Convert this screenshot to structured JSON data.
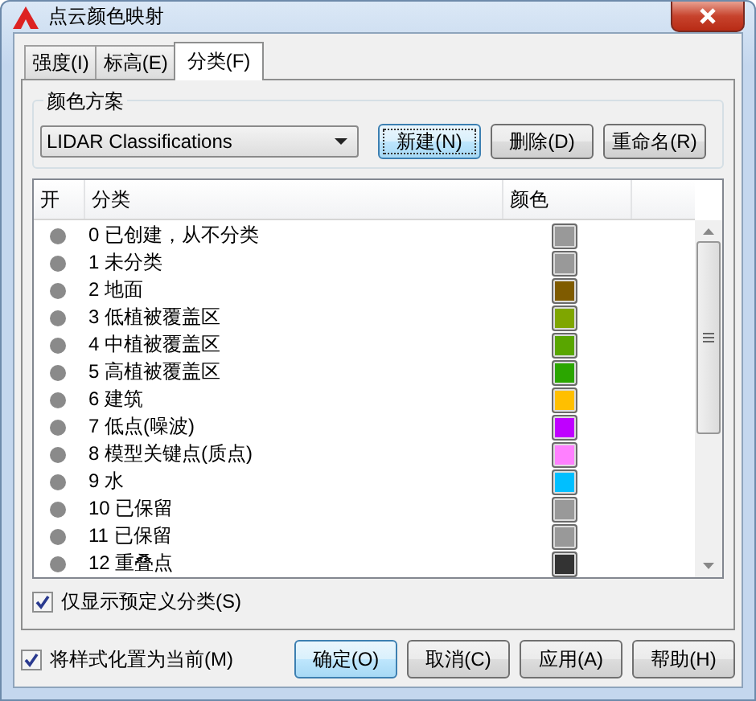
{
  "window": {
    "title": "点云颜色映射"
  },
  "tabs": [
    {
      "label": "强度(I)",
      "selected": false
    },
    {
      "label": "标高(E)",
      "selected": false
    },
    {
      "label": "分类(F)",
      "selected": true
    }
  ],
  "color_scheme": {
    "legend": "颜色方案",
    "value": "LIDAR Classifications",
    "buttons": [
      {
        "label": "新建(N)",
        "focused": true
      },
      {
        "label": "删除(D)",
        "focused": false
      },
      {
        "label": "重命名(R)",
        "focused": false
      }
    ]
  },
  "table": {
    "columns": [
      "开",
      "分类",
      "颜色"
    ],
    "rows": [
      {
        "on": true,
        "name": "0 已创建，从不分类",
        "color": "#999999"
      },
      {
        "on": true,
        "name": "1 未分类",
        "color": "#999999"
      },
      {
        "on": true,
        "name": "2 地面",
        "color": "#7f5b00"
      },
      {
        "on": true,
        "name": "3 低植被覆盖区",
        "color": "#7fa600"
      },
      {
        "on": true,
        "name": "4 中植被覆盖区",
        "color": "#59a600"
      },
      {
        "on": true,
        "name": "5 高植被覆盖区",
        "color": "#2ba600"
      },
      {
        "on": true,
        "name": "6 建筑",
        "color": "#ffbf00"
      },
      {
        "on": true,
        "name": "7 低点(噪波)",
        "color": "#bf00ff"
      },
      {
        "on": true,
        "name": "8 模型关键点(质点)",
        "color": "#ff80ff"
      },
      {
        "on": true,
        "name": "9 水",
        "color": "#00bfff"
      },
      {
        "on": true,
        "name": "10 已保留",
        "color": "#999999"
      },
      {
        "on": true,
        "name": "11 已保留",
        "color": "#999999"
      },
      {
        "on": true,
        "name": "12 重叠点",
        "color": "#333333"
      }
    ]
  },
  "predefined_only": {
    "label": "仅显示预定义分类(S)",
    "checked": true
  },
  "set_current": {
    "label": "将样式化置为当前(M)",
    "checked": true
  },
  "buttons": [
    {
      "label": "确定(O)",
      "default": true
    },
    {
      "label": "取消(C)",
      "default": false
    },
    {
      "label": "应用(A)",
      "default": false
    },
    {
      "label": "帮助(H)",
      "default": false
    }
  ]
}
